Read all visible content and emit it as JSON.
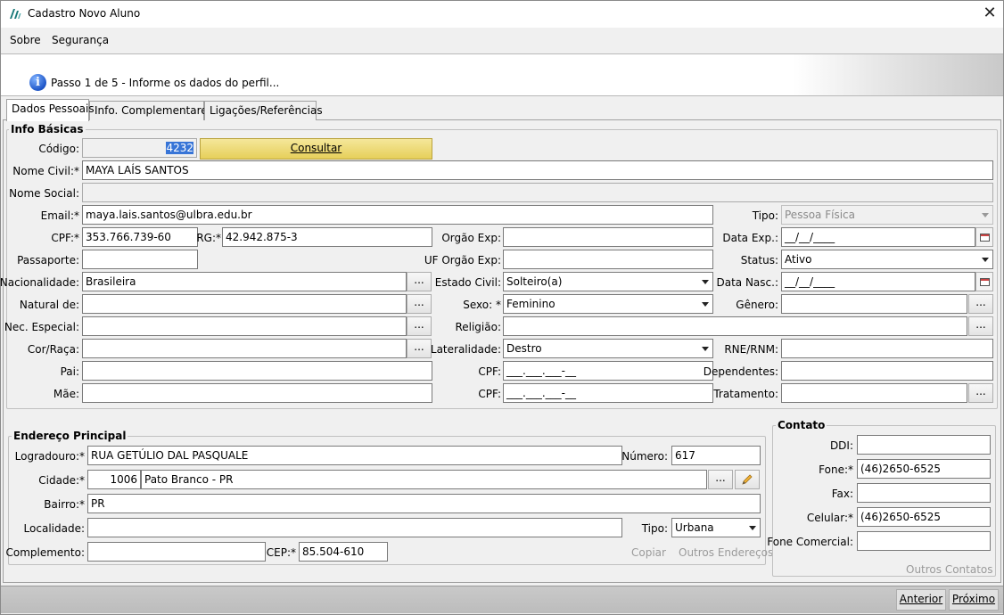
{
  "window": {
    "title": "Cadastro Novo Aluno"
  },
  "menu": {
    "sobre": "Sobre",
    "seguranca": "Segurança"
  },
  "banner": {
    "text": "Passo 1 de 5 - Informe os dados do perfil..."
  },
  "tabs": [
    "Dados Pessoais",
    "Info. Complementares",
    "Ligações/Referências"
  ],
  "info": {
    "legend": "Info Básicas",
    "codigo_label": "Código:",
    "codigo": "4232",
    "consultar": "Consultar",
    "nome_civil_label": "Nome Civil:*",
    "nome_civil": "MAYA LAÍS SANTOS",
    "nome_social_label": "Nome Social:",
    "nome_social": "",
    "email_label": "Email:*",
    "email": "maya.lais.santos@ulbra.edu.br",
    "tipo_label": "Tipo:",
    "tipo": "Pessoa Física",
    "cpf_label": "CPF:*",
    "cpf": "353.766.739-60",
    "rg_label": "RG:*",
    "rg": "42.942.875-3",
    "orgao_label": "Orgão Exp:",
    "orgao": "",
    "data_exp_label": "Data Exp.:",
    "data_exp": "__/__/____",
    "passaporte_label": "Passaporte:",
    "passaporte": "",
    "uf_orgao_label": "UF Orgão Exp:",
    "uf_orgao": "",
    "status_label": "Status:",
    "status": "Ativo",
    "nacionalidade_label": "Nacionalidade:",
    "nacionalidade": "Brasileira",
    "estado_civil_label": "Estado Civil:",
    "estado_civil": "Solteiro(a)",
    "data_nasc_label": "Data Nasc.:",
    "data_nasc": "__/__/____",
    "natural_label": "Natural de:",
    "natural": "",
    "sexo_label": "Sexo: *",
    "sexo": "Feminino",
    "genero_label": "Gênero:",
    "genero": "",
    "nec_label": "Nec. Especial:",
    "nec": "",
    "religiao_label": "Religião:",
    "religiao": "",
    "cor_label": "Cor/Raça:",
    "cor": "",
    "lateralidade_label": "Lateralidade:",
    "lateralidade": "Destro",
    "rne_label": "RNE/RNM:",
    "rne": "",
    "pai_label": "Pai:",
    "pai": "",
    "cpf_pai_label": "CPF:",
    "cpf_pai": "___.___.___-__",
    "dependentes_label": "Dependentes:",
    "dependentes": "",
    "mae_label": "Mãe:",
    "mae": "",
    "cpf_mae_label": "CPF:",
    "cpf_mae": "___.___.___-__",
    "tratamento_label": "Tratamento:",
    "tratamento": "",
    "dots": "..."
  },
  "endereco": {
    "legend": "Endereço Principal",
    "logradouro_label": "Logradouro:*",
    "logradouro": "RUA GETÚLIO DAL PASQUALE",
    "numero_label": "Número:",
    "numero": "617",
    "cidade_label": "Cidade:*",
    "cidade_cod": "1006",
    "cidade": "Pato Branco - PR",
    "bairro_label": "Bairro:*",
    "bairro": "PR",
    "localidade_label": "Localidade:",
    "localidade": "",
    "tipo_label": "Tipo:",
    "tipo": "Urbana",
    "complemento_label": "Complemento:",
    "complemento": "",
    "cep_label": "CEP:*",
    "cep": "85.504-610",
    "copiar": "Copiar",
    "outros_enderecos": "Outros Endereços"
  },
  "contato": {
    "legend": "Contato",
    "ddi_label": "DDI:",
    "ddi": "",
    "fone_label": "Fone:*",
    "fone": "(46)2650-6525",
    "fax_label": "Fax:",
    "fax": "",
    "celular_label": "Celular:*",
    "celular": "(46)2650-6525",
    "fone_comercial_label": "Fone Comercial:",
    "fone_comercial": "",
    "outros_contatos": "Outros Contatos"
  },
  "footer": {
    "anterior": "Anterior",
    "proximo": "Próximo"
  }
}
